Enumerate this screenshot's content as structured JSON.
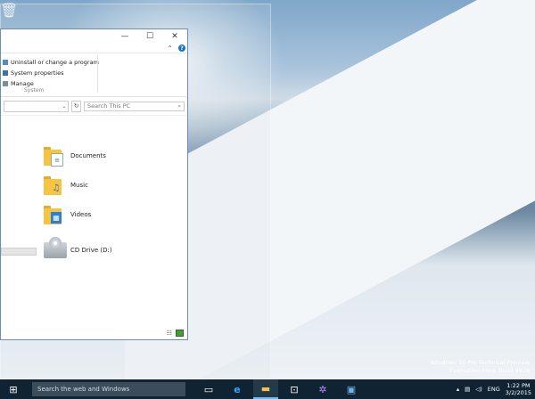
{
  "explorer": {
    "ribbon_items": [
      {
        "label": "Uninstall or change a program",
        "icon": "uninstall-icon"
      },
      {
        "label": "System properties",
        "icon": "system-properties-icon"
      },
      {
        "label": "Manage",
        "icon": "manage-icon"
      }
    ],
    "ribbon_group_label": "System",
    "search_placeholder": "Search This PC",
    "folders": [
      {
        "label": "Documents",
        "icon": "documents-folder-icon"
      },
      {
        "label": "Music",
        "icon": "music-folder-icon"
      },
      {
        "label": "Videos",
        "icon": "videos-folder-icon"
      }
    ],
    "drive_label": "CD Drive (D:)"
  },
  "watermark": {
    "line1": "Windows 10 Pro Technical Preview",
    "line2": "Evaluation copy. Build 9926"
  },
  "taskbar": {
    "search_placeholder": "Search the web and Windows",
    "language": "ENG",
    "time": "1:22 PM",
    "date": "3/2/2015"
  },
  "colors": {
    "taskbar_bg": "#0f2333",
    "window_border": "#6b8fb5",
    "folder_yellow": "#f5c542",
    "accent_blue": "#1a73c9"
  }
}
